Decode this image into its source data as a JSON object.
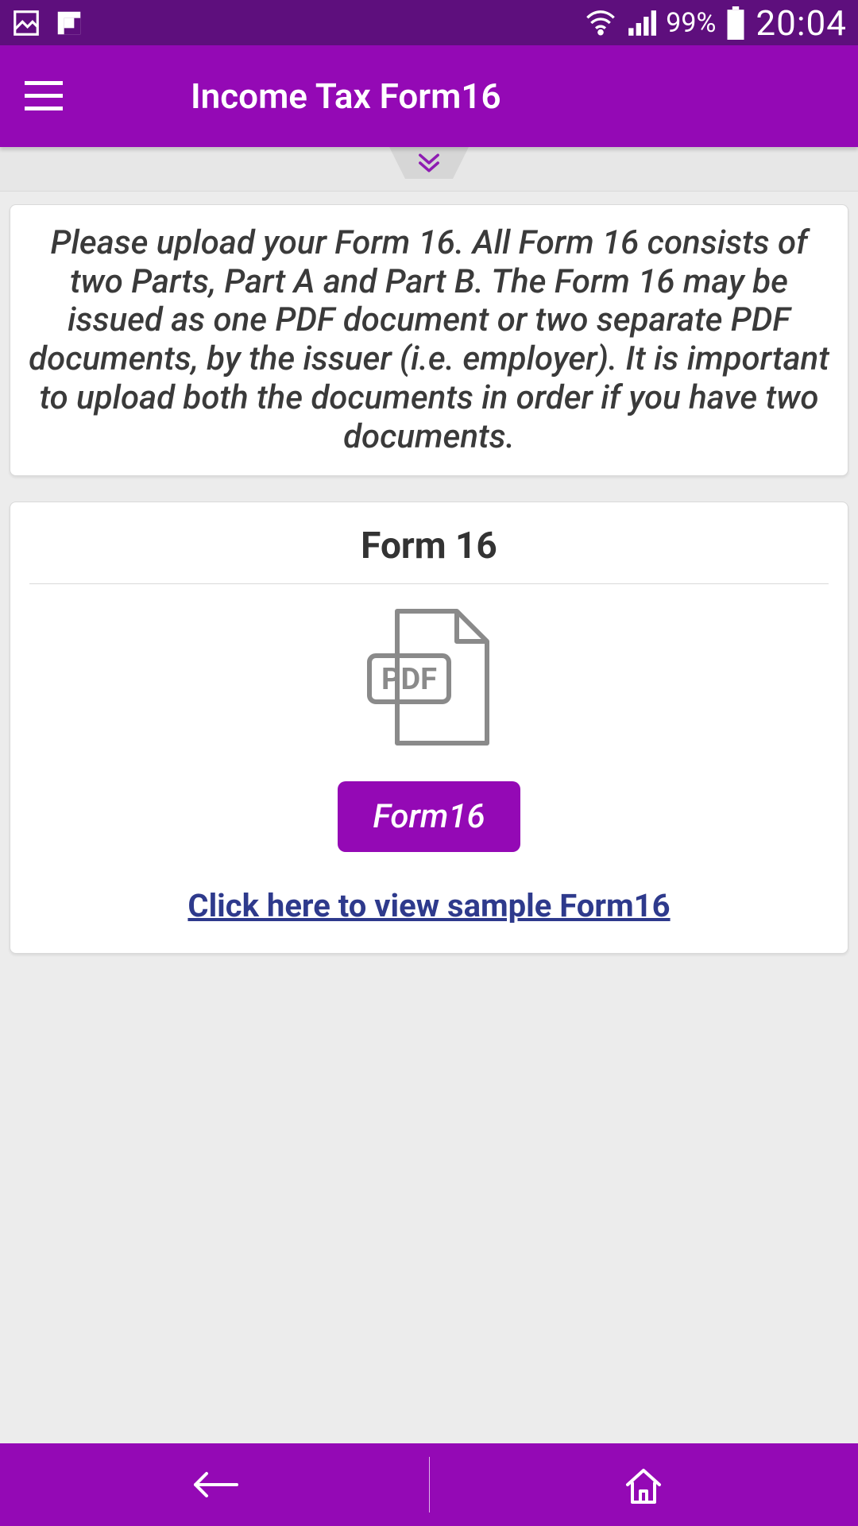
{
  "statusbar": {
    "battery_pct": "99%",
    "time": "20:04"
  },
  "appbar": {
    "title": "Income Tax Form16"
  },
  "info_card": {
    "text": "Please upload your Form 16. All Form 16 consists of two Parts, Part A and Part B. The Form 16 may be issued as one PDF document or two separate PDF documents, by the issuer (i.e. employer). It is important to upload both the documents in order if you have two documents."
  },
  "form_card": {
    "title": "Form 16",
    "pdf_badge": "PDF",
    "upload_button_label": "Form16",
    "sample_link_label": "Click here to view sample Form16"
  },
  "colors": {
    "statusbar_bg": "#5E0F7D",
    "appbar_bg": "#9409B5",
    "accent": "#9409B5",
    "link": "#2E3A8C"
  }
}
